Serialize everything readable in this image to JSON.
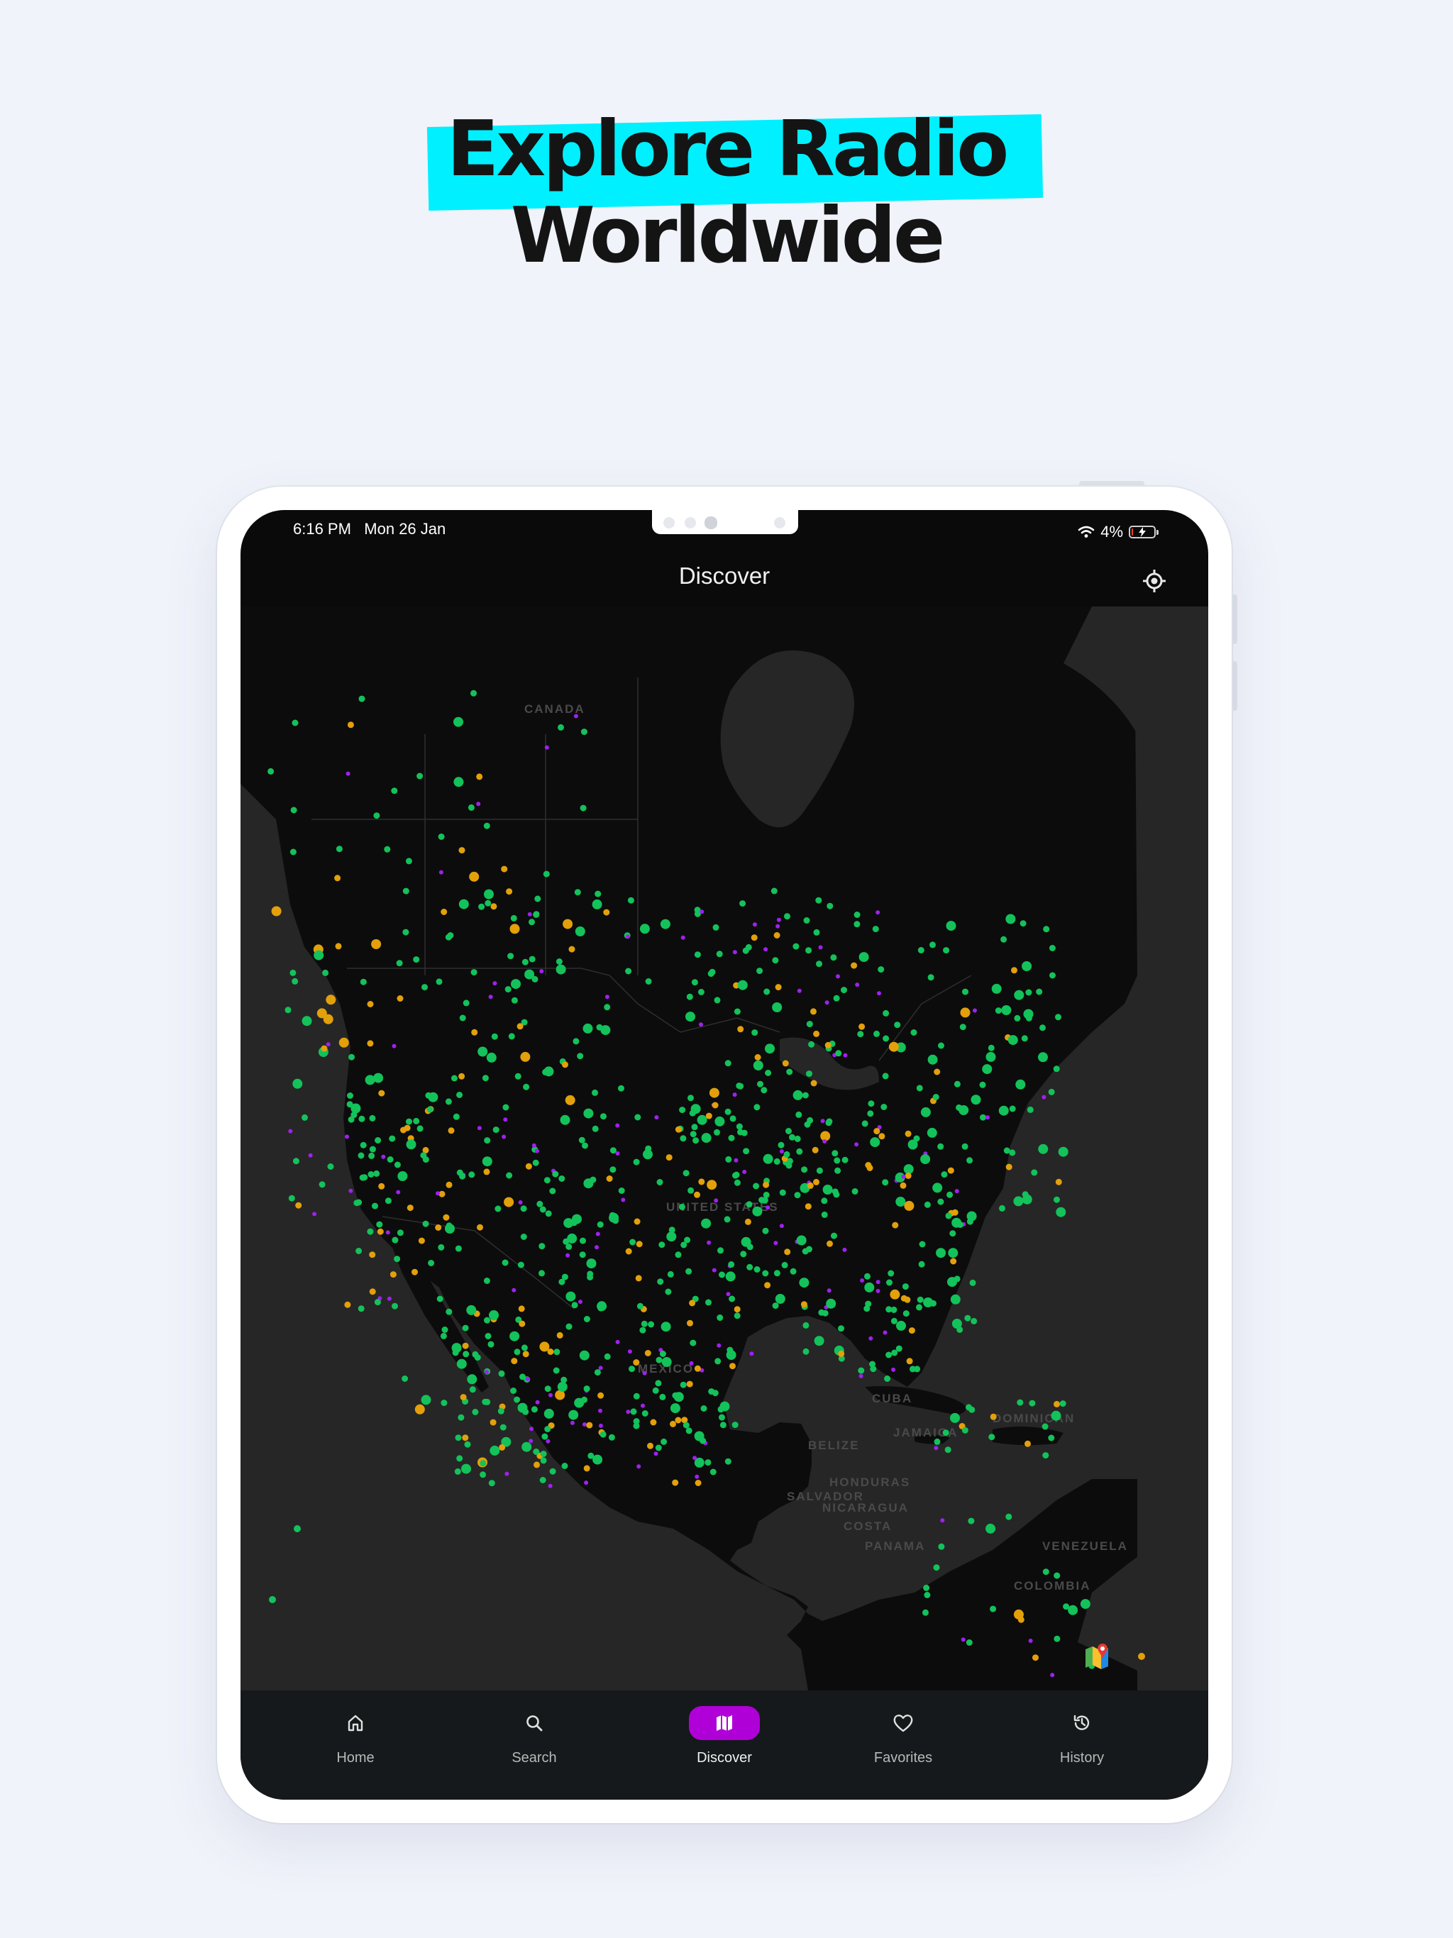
{
  "headline": {
    "line1": "Explore Radio",
    "line2": "Worldwide"
  },
  "colors": {
    "highlight": "#00f0ff",
    "accent": "#b000d8",
    "dot_green": "#13c25a",
    "dot_orange": "#e3a00b",
    "dot_purple": "#a020f0"
  },
  "status_bar": {
    "time": "6:16 PM",
    "date": "Mon 26 Jan",
    "battery": "4%",
    "battery_level": 0.04,
    "wifi_icon": "wifi-icon",
    "battery_icon": "battery-charging-icon"
  },
  "app": {
    "title": "Discover",
    "locate_icon": "crosshair-icon"
  },
  "map": {
    "labels": [
      "CANADA",
      "UNITED STATES",
      "MEXICO",
      "CUBA",
      "BELIZE",
      "HONDURAS",
      "SALVADOR",
      "NICARAGUA",
      "COSTA",
      "PANAMA",
      "JAMAICA",
      "DOMINICAN",
      "VENEZUELA",
      "COLOMBIA"
    ],
    "attribution_icon": "google-maps-icon"
  },
  "nav": {
    "items": [
      {
        "label": "Home",
        "icon": "home-icon"
      },
      {
        "label": "Search",
        "icon": "search-icon"
      },
      {
        "label": "Discover",
        "icon": "map-icon",
        "active": true
      },
      {
        "label": "Favorites",
        "icon": "heart-icon"
      },
      {
        "label": "History",
        "icon": "history-icon"
      }
    ]
  }
}
